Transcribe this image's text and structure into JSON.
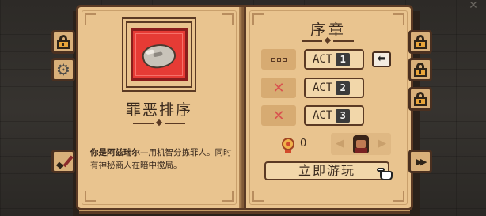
{
  "left_page": {
    "item_name": "罪恶排序",
    "description_hl": "你是阿兹瑞尔",
    "description_rest": "—用机智分拣罪人。同时有神秘商人在暗中搅局。",
    "item_icon": "rock-icon"
  },
  "right_page": {
    "chapter_title": "序章",
    "acts": [
      {
        "label": "ACT",
        "number": "1",
        "status": "current"
      },
      {
        "label": "ACT",
        "number": "2",
        "status": "locked"
      },
      {
        "label": "ACT",
        "number": "3",
        "status": "locked"
      }
    ],
    "medal_count": "0",
    "play_label": "立即游玩"
  },
  "side_buttons": {
    "left": [
      "lock-icon",
      "gear-icon",
      "brush-icon"
    ],
    "right": [
      "lock-icon",
      "lock-icon",
      "lock-icon",
      "fast-forward-icon"
    ]
  },
  "colors": {
    "page": "#e9c48f",
    "border": "#5b3a24",
    "card_red": "#e63b35",
    "lock_gold": "#e9a53a"
  }
}
